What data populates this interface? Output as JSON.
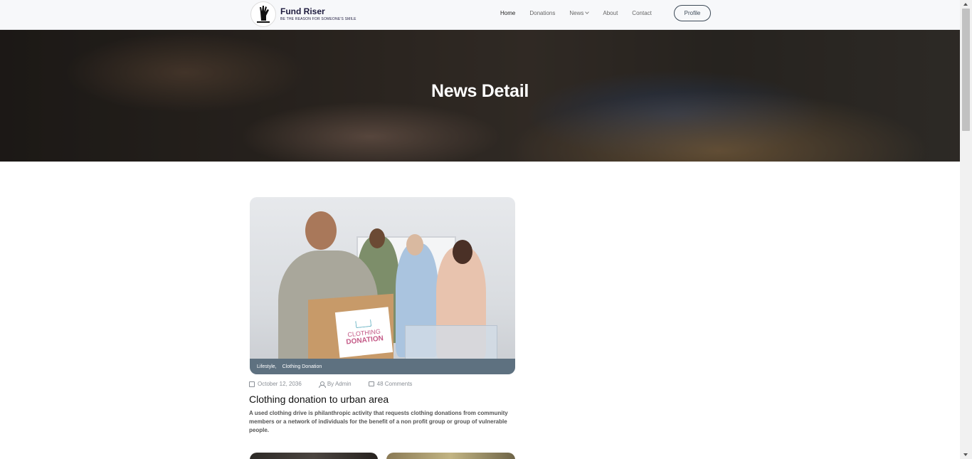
{
  "brand": {
    "name": "Fund Riser",
    "tagline": "BE THE REASON FOR SOMEONE'S SMILE"
  },
  "nav": {
    "items": [
      {
        "label": "Home",
        "active": true
      },
      {
        "label": "Donations",
        "active": false
      },
      {
        "label": "News",
        "active": false,
        "dropdown": true
      },
      {
        "label": "About",
        "active": false
      },
      {
        "label": "Contact",
        "active": false
      }
    ],
    "profile_label": "Profile"
  },
  "hero": {
    "title": "News Detail"
  },
  "article": {
    "image_label": {
      "line1": "CLOTHING",
      "line2": "DONATION"
    },
    "categories": [
      "Lifestyle,",
      "Clothing Donation"
    ],
    "date": "October 12, 2036",
    "author": "By Admin",
    "comments": "48 Comments",
    "title": "Clothing donation to urban area",
    "excerpt": "A used clothing drive is philanthropic activity that requests clothing donations from community members or a network of individuals for the benefit of a non profit group or group of vulnerable people."
  },
  "icons": {
    "date": "calendar-icon",
    "author": "user-icon",
    "comments": "comment-icon",
    "dropdown": "chevron-down-icon"
  },
  "colors": {
    "brand_text": "#1d1a3d",
    "category_bar": "#5e7180",
    "profile_border": "#3d4a57"
  }
}
